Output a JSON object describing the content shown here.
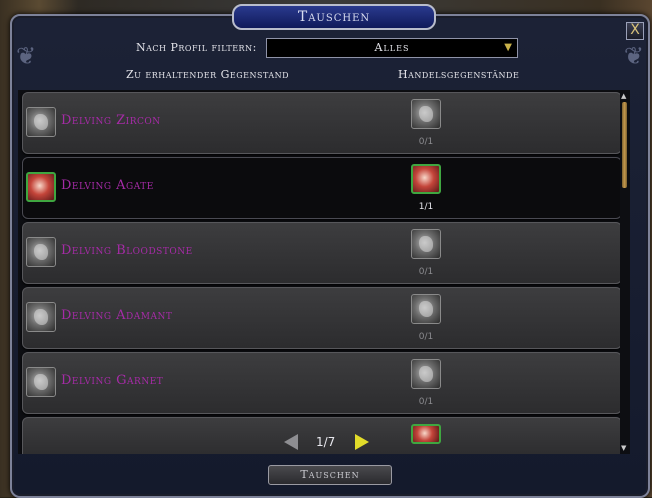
{
  "window": {
    "title": "Tauschen",
    "close_glyph": "X"
  },
  "filter": {
    "label": "Nach Profil filtern:",
    "selected": "Alles"
  },
  "columns": {
    "receive": "Zu erhaltender Gegenstand",
    "trade": "Handelsgegenstände"
  },
  "items": [
    {
      "name": "Delving Zircon",
      "qty": "0/1",
      "icon": "zircon-gem-icon",
      "available": false
    },
    {
      "name": "Delving Agate",
      "qty": "1/1",
      "icon": "agate-gem-icon",
      "available": true
    },
    {
      "name": "Delving Bloodstone",
      "qty": "0/1",
      "icon": "bloodstone-gem-icon",
      "available": false
    },
    {
      "name": "Delving Adamant",
      "qty": "0/1",
      "icon": "adamant-gem-icon",
      "available": false
    },
    {
      "name": "Delving Garnet",
      "qty": "0/1",
      "icon": "garnet-gem-icon",
      "available": false
    }
  ],
  "pagination": {
    "text": "1/7"
  },
  "action": {
    "label": "Tauschen"
  },
  "colors": {
    "item_name": "#a52ba6",
    "available_border": "#3fa640",
    "next_arrow": "#e2dc2a"
  }
}
